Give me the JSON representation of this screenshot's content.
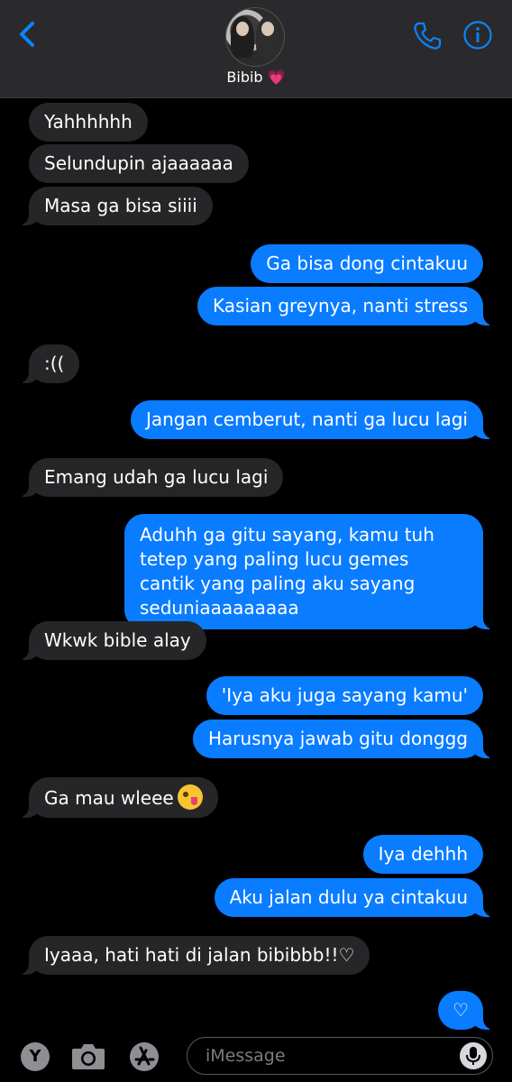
{
  "header": {
    "contact_name": "Bibib",
    "heart": "💗"
  },
  "messages": [
    {
      "from": "them",
      "text": "Yahhhhhh"
    },
    {
      "from": "them",
      "text": "Selundupin ajaaaaaa"
    },
    {
      "from": "them",
      "text": "Masa ga bisa siiii"
    },
    {
      "from": "me",
      "text": "Ga bisa dong cintakuu"
    },
    {
      "from": "me",
      "text": "Kasian greynya, nanti stress"
    },
    {
      "from": "them",
      "text": ":(("
    },
    {
      "from": "me",
      "text": "Jangan cemberut, nanti ga lucu lagi"
    },
    {
      "from": "them",
      "text": "Emang udah ga lucu lagi"
    },
    {
      "from": "me",
      "text": "Aduhh ga gitu sayang, kamu tuh tetep yang paling lucu gemes cantik yang paling aku sayang seduniaaaaaaaaa"
    },
    {
      "from": "them",
      "text": "Wkwk bible alay"
    },
    {
      "from": "me",
      "text": "'Iya aku juga sayang kamu'"
    },
    {
      "from": "me",
      "text": "Harusnya jawab gitu donggg"
    },
    {
      "from": "them",
      "text": "Ga mau wleee"
    },
    {
      "from": "me",
      "text": "Iya dehhh"
    },
    {
      "from": "me",
      "text": "Aku jalan dulu ya cintakuu"
    },
    {
      "from": "them",
      "text": "Iyaaa, hati hati di jalan bibibbb!!♡"
    },
    {
      "from": "me",
      "text": "♡"
    }
  ],
  "input": {
    "placeholder": "iMessage",
    "y_app_label": "Y"
  },
  "icons": [
    "back-chevron-icon",
    "phone-icon",
    "info-icon",
    "camera-icon",
    "app-store-icon",
    "microphone-icon",
    "grinning-face-with-tongue-emoji"
  ],
  "colors": {
    "sent_bubble": "#0a7cff",
    "received_bubble": "#262628",
    "accent": "#0a84ff",
    "background": "#000000"
  }
}
